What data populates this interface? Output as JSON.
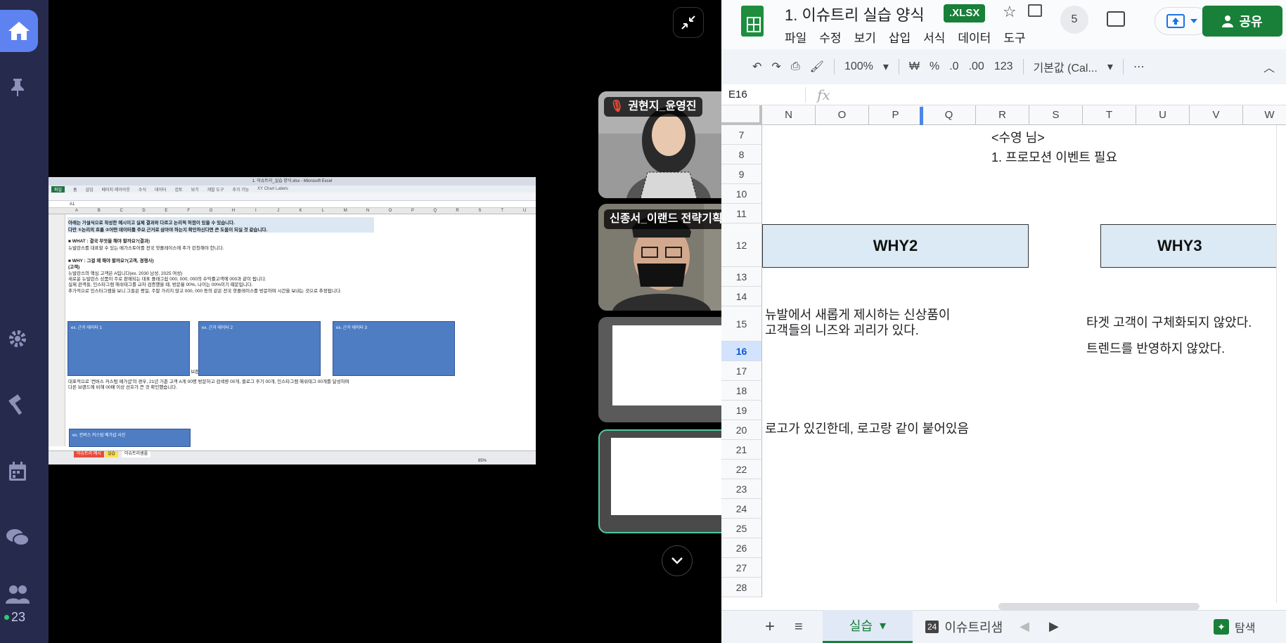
{
  "rail": {
    "participant_count": "23"
  },
  "shared_screen": {
    "title_bar": "1. 이슈트리_실습 양식.xlsx - Microsoft Excel",
    "ribbon_tabs": [
      "파일",
      "홈",
      "삽입",
      "페이지 레이아웃",
      "수식",
      "데이터",
      "검토",
      "보기",
      "개발 도구",
      "추가 기능",
      "XY Chart Labels"
    ],
    "name_box": "A1",
    "columns": [
      "A",
      "B",
      "C",
      "D",
      "E",
      "F",
      "G",
      "H",
      "I",
      "J",
      "K",
      "L",
      "M",
      "N",
      "O",
      "P",
      "Q",
      "R",
      "S",
      "T",
      "U"
    ],
    "lines": [
      {
        "text": "아래는 가설식으로 작성한 예시이고 실제 결과와 다르고 논리적 허점이 있을 수 있습니다.",
        "bold": true
      },
      {
        "text": "다만 ①논리의 흐름 ②어떤 데이터를 주요 근거로 삼아야 하는지 확인하신다면 큰 도움이 되실 것 같습니다.",
        "bold": true
      },
      {
        "text": "■ WHAT : 결국 무엇을 해야 할까요?(결과)",
        "bold": true
      },
      {
        "text": "뉴발란스를 대표할 수 있는 메가스토어를 전국 핫플레이스에 추가 런칭해야 한니다.",
        "bold": false
      },
      {
        "text": "■ WHY : 그걸 왜 해야 할까요?(고객, 경쟁사)",
        "bold": true
      },
      {
        "text": "(고객)",
        "bold": true
      },
      {
        "text": "뉴발란스의 핵심 고객은 A입니다(ex. 2030 남성, 2025 여성)",
        "bold": false
      },
      {
        "text": "새로운 뉴발란스 상품이 주로 판매되는 대표 플래그쉽 000, 000, 000의 수익률고객에 000과 같이 됩니다.",
        "bold": false
      },
      {
        "text": "실제 관객들, 인스타그램 해쉬태그를 교차 검증했을 때, 방문율 00%, 나이는 00%이기 때문입니다.",
        "bold": false
      },
      {
        "text": "추가적으로 인스타그램을 보니 그들은 평일, 주말 가리지 않고 000, 000 등의 같은 전국 핫플레이스를 방문하며 시간을 보내는 것으로 추정됩니다.",
        "bold": false
      },
      {
        "text": "(경쟁사)",
        "bold": true
      },
      {
        "text": "그런 고객 A가 주로 구매하는 브랜드 00개를 살펴보니 00% 이상 브랜드를 대표할 수 있는 메가샵을 보유하고 있었습니다.",
        "bold": false
      },
      {
        "text": "대표적으로 '컨버스 커스텀 메가샵'의 경우, 21년 기준 고객 A게 00명 방문하고 검색량 00개, 블로그 후기 00개, 인스타그램 해쉬태그 00개를 달성하며",
        "bold": false
      },
      {
        "text": "다른 브랜드에 비해 00배 이상 선호가 큰 것 확인했습니다.",
        "bold": false
      }
    ],
    "evidence_boxes": [
      "ex. 근거 데이터 1",
      "ex. 근거 데이터 2",
      "ex. 근거 데이터 3"
    ],
    "bottom_box": "ex. 컨버스 커스텀 메가샵 사진",
    "sheet_tabs": [
      "이슈트리 예시",
      "실습",
      "이슈트리샘플"
    ],
    "zoom": "85%"
  },
  "video_tiles": [
    {
      "name": "권현지_윤영진",
      "muted": true
    },
    {
      "name": "신종서_이랜드 전략기획..."
    },
    {
      "name": ""
    },
    {
      "name": ""
    }
  ],
  "sheets": {
    "doc_title": "1. 이슈트리 실습 양식",
    "file_badge": ".XLSX",
    "menu": [
      "파일",
      "수정",
      "보기",
      "삽입",
      "서식",
      "데이터",
      "도구"
    ],
    "user_count": "5",
    "share_label": "공유",
    "toolbar": {
      "zoom": "100%",
      "currency": "₩",
      "percent": "%",
      "dec_decrease": ".0",
      "dec_increase": ".00",
      "number_format": "123",
      "font": "기본값 (Cal..."
    },
    "name_box": "E16",
    "fx": "fx",
    "columns": [
      "N",
      "O",
      "P",
      "Q",
      "R",
      "S",
      "T",
      "U",
      "V",
      "W"
    ],
    "rows": [
      "7",
      "8",
      "9",
      "10",
      "11",
      "12",
      "13",
      "14",
      "15",
      "16",
      "17",
      "18",
      "19",
      "20",
      "21",
      "22",
      "23",
      "24",
      "25",
      "26",
      "27",
      "28"
    ],
    "selected_row": "16",
    "cells": {
      "s7": "<수영 님>",
      "s8": "1. 프로모션 이벤트 필요",
      "why2": "WHY2",
      "why3": "WHY3",
      "n15a": "뉴발에서 새롭게 제시하는 신상품이",
      "n15b": "고객들의 니즈와 괴리가 있다.",
      "t15": "타겟 고객이 구체화되지 않았다.",
      "t16": "트렌드를 반영하지 않았다.",
      "n20": "로고가 있긴한데, 로고랑 같이 붙어있음"
    },
    "sheet_tabs": {
      "active": "실습",
      "other": "이슈트리샘",
      "other_badge": "24"
    },
    "explore_label": "탐색"
  },
  "colors": {
    "rail_bg": "#262b4d",
    "home_active": "#5e83f0",
    "sheets_green": "#188038",
    "why_fill": "#dbeaf4",
    "excel_box": "#4e7dc4"
  }
}
